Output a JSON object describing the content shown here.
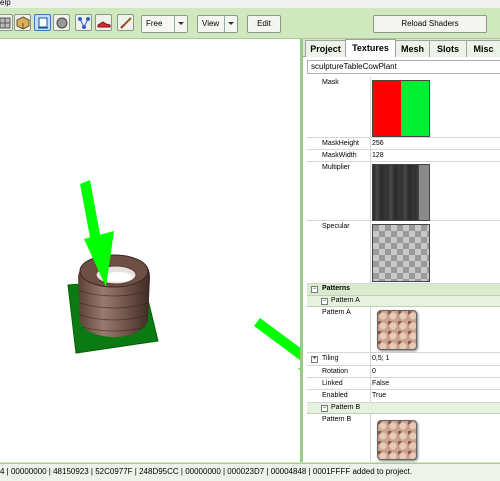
{
  "menubar": {
    "help_fragment": "elp"
  },
  "toolbar": {
    "camera_mode": "Free",
    "view_label": "View",
    "edit_label": "Edit",
    "reload_label": "Reload Shaders",
    "tool_icons": [
      "grid-icon",
      "cube-icon",
      "box-select-icon",
      "sphere-icon",
      "node-icon",
      "shoe-icon",
      "knife-icon"
    ]
  },
  "panel": {
    "tabs": [
      "Project",
      "Textures",
      "Mesh",
      "Slots",
      "Misc"
    ],
    "selected_tab": "Textures",
    "object_name": "sculptureTableCowPlant",
    "properties": {
      "mask": "Mask",
      "mask_height_label": "MaskHeight",
      "mask_height_value": "256",
      "mask_width_label": "MaskWidth",
      "mask_width_value": "128",
      "multiplier": "Multiplier",
      "specular": "Specular",
      "patterns_category": "Patterns",
      "pattern_a_category": "Pattern A",
      "pattern_a_label": "Pattern A",
      "tiling_label": "Tiling",
      "tiling_value": "0,5; 1",
      "rotation_label": "Rotation",
      "rotation_value": "0",
      "linked_label": "Linked",
      "linked_value": "False",
      "enabled_label": "Enabled",
      "enabled_value": "True",
      "pattern_b_category": "Pattern B",
      "pattern_b_label": "Pattern B"
    },
    "colors": {
      "mask_red": "#ff0000",
      "mask_green": "#00ee33",
      "accent": "#00ff00"
    }
  },
  "status": {
    "text": "4 | 00000000 | 48150923 | 52C0977F | 248D95CC | 00000000 | 000023D7 | 00004848 | 0001FFFF added to project."
  }
}
